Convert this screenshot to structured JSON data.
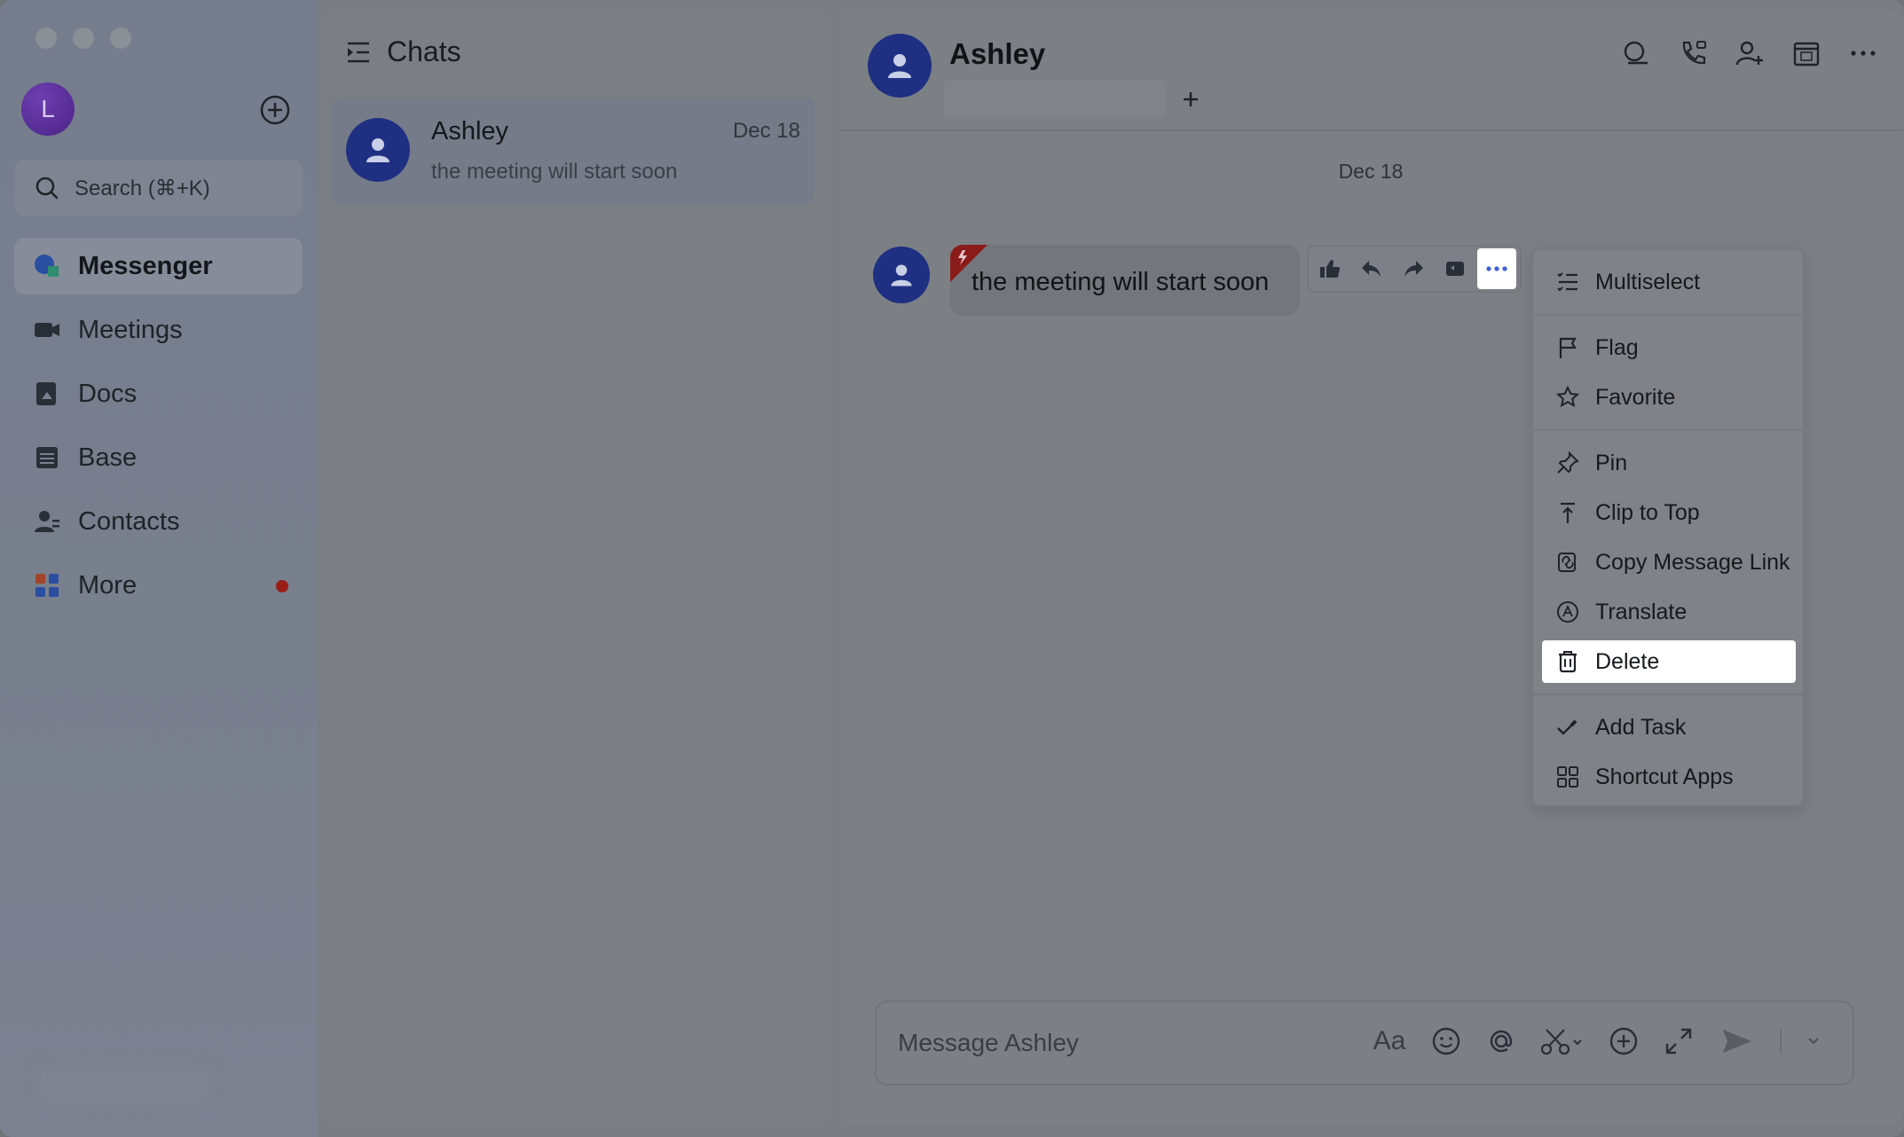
{
  "nav": {
    "user_initial": "L",
    "search_placeholder": "Search (⌘+K)",
    "items": [
      {
        "label": "Messenger",
        "icon": "messenger-icon",
        "active": true
      },
      {
        "label": "Meetings",
        "icon": "video-camera-icon"
      },
      {
        "label": "Docs",
        "icon": "docs-icon"
      },
      {
        "label": "Base",
        "icon": "base-grid-icon"
      },
      {
        "label": "Contacts",
        "icon": "contacts-icon"
      },
      {
        "label": "More",
        "icon": "apps-icon",
        "badge": true
      }
    ]
  },
  "chatlist": {
    "title": "Chats",
    "items": [
      {
        "name": "Ashley",
        "date": "Dec 18",
        "preview": "the meeting will start soon"
      }
    ]
  },
  "conversation": {
    "name": "Ashley",
    "date_separator": "Dec 18",
    "message": "the meeting will start soon",
    "composer_placeholder": "Message Ashley",
    "format_label": "Aa"
  },
  "menu": {
    "items": [
      {
        "label": "Multiselect",
        "icon": "multiselect-icon"
      },
      {
        "label": "Flag",
        "icon": "flag-icon"
      },
      {
        "label": "Favorite",
        "icon": "star-icon"
      },
      {
        "label": "Pin",
        "icon": "pin-icon"
      },
      {
        "label": "Clip to Top",
        "icon": "clip-to-top-icon"
      },
      {
        "label": "Copy Message Link",
        "icon": "link-icon"
      },
      {
        "label": "Translate",
        "icon": "translate-icon"
      },
      {
        "label": "Delete",
        "icon": "trash-icon",
        "highlighted": true
      },
      {
        "label": "Add Task",
        "icon": "task-check-icon"
      },
      {
        "label": "Shortcut Apps",
        "icon": "shortcut-apps-icon"
      }
    ]
  },
  "colors": {
    "accent_blue": "#1f3083",
    "highlight": "#ffffff",
    "flag_red": "#9a1d1a"
  }
}
